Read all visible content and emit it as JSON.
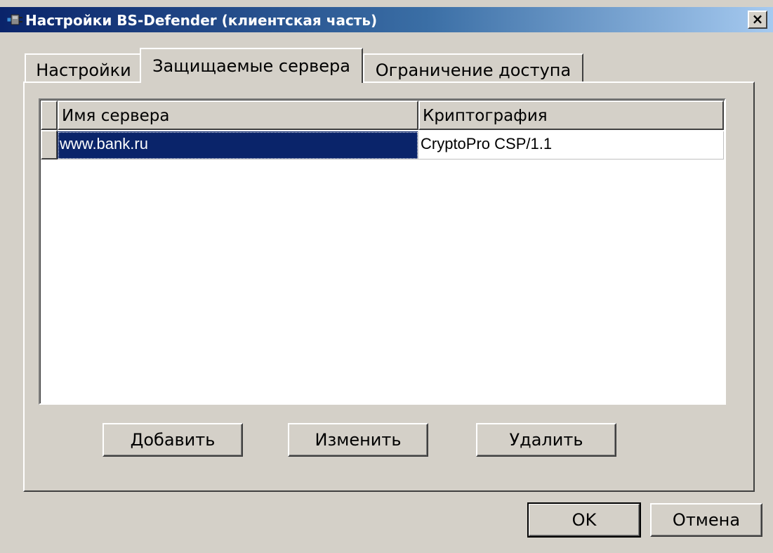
{
  "window": {
    "title": "Настройки BS-Defender (клиентская часть)",
    "close_label": "×"
  },
  "tabs": [
    {
      "label": "Настройки",
      "active": false
    },
    {
      "label": "Защищаемые сервера",
      "active": true
    },
    {
      "label": "Ограничение доступа",
      "active": false
    }
  ],
  "grid": {
    "columns": [
      "Имя сервера",
      "Криптография"
    ],
    "rows": [
      {
        "server": "www.bank.ru",
        "crypto": "CryptoPro CSP/1.1",
        "selected": true
      }
    ]
  },
  "actions": {
    "add_label": "Добавить",
    "edit_label": "Изменить",
    "delete_label": "Удалить"
  },
  "dialog": {
    "ok_label": "OK",
    "cancel_label": "Отмена"
  },
  "colors": {
    "title_start": "#0a246a",
    "title_end": "#a6caf0",
    "selection": "#0a246a",
    "face": "#d4d0c8"
  },
  "icons": {
    "title": "app-plug-icon"
  }
}
